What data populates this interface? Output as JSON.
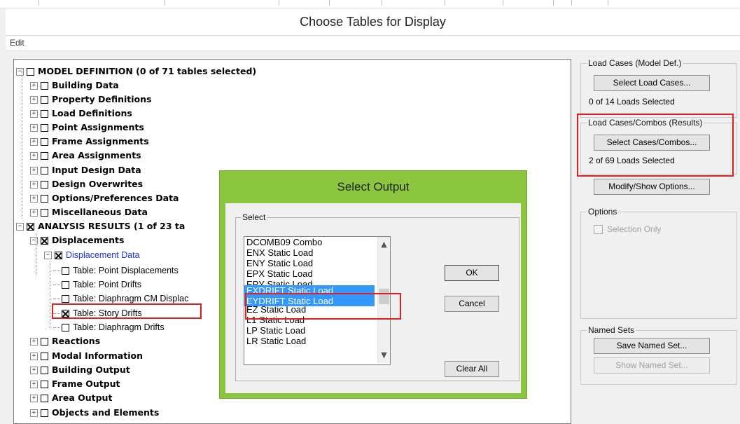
{
  "window": {
    "title": "Choose Tables for Display"
  },
  "menu": {
    "edit": "Edit"
  },
  "tree": {
    "model_definition": "MODEL DEFINITION  (0 of 71 tables selected)",
    "building_data": "Building Data",
    "property_definitions": "Property Definitions",
    "load_definitions": "Load Definitions",
    "point_assignments": "Point Assignments",
    "frame_assignments": "Frame Assignments",
    "area_assignments": "Area Assignments",
    "input_design_data": "Input Design Data",
    "design_overwrites": "Design Overwrites",
    "options_preferences": "Options/Preferences Data",
    "miscellaneous": "Miscellaneous Data",
    "analysis_results": "ANALYSIS RESULTS  (1 of 23 ta",
    "displacements": "Displacements",
    "displacement_data": "Displacement Data",
    "point_displacements": "Table:  Point Displacements",
    "point_drifts": "Table:  Point Drifts",
    "diaphragm_cm": "Table:  Diaphragm CM Displac",
    "story_drifts": "Table:  Story Drifts",
    "diaphragm_drifts": "Table:  Diaphragm Drifts",
    "reactions": "Reactions",
    "modal_information": "Modal Information",
    "building_output": "Building Output",
    "frame_output": "Frame Output",
    "area_output": "Area Output",
    "objects_elements": "Objects and Elements"
  },
  "right_panel": {
    "load_cases_group": "Load Cases (Model Def.)",
    "select_load_cases": "Select Load Cases...",
    "load_cases_count": "0  of  14  Loads Selected",
    "load_combos_group": "Load Cases/Combos (Results)",
    "select_cases_combos": "Select Cases/Combos...",
    "combos_count": "2  of  69  Loads Selected",
    "modify_show_options": "Modify/Show Options...",
    "options_group": "Options",
    "selection_only": "Selection Only",
    "named_sets_group": "Named Sets",
    "save_named_set": "Save Named Set...",
    "show_named_set": "Show Named Set..."
  },
  "dialog": {
    "title": "Select Output",
    "select_group": "Select",
    "items": [
      "DCOMB09 Combo",
      "ENX Static Load",
      "ENY Static Load",
      "EPX Static Load",
      "EPY Static Load",
      "EXDRIFT Static Load",
      "EYDRIFT Static Load",
      "EZ Static Load",
      "L1 Static Load",
      "LP Static Load",
      "LR Static Load"
    ],
    "ok": "OK",
    "cancel": "Cancel",
    "clear_all": "Clear All"
  },
  "colors": {
    "dialog_accent": "#8cc63f",
    "selection": "#3399ff",
    "highlight_box": "#e02020",
    "tree_link": "#1c35d6"
  }
}
